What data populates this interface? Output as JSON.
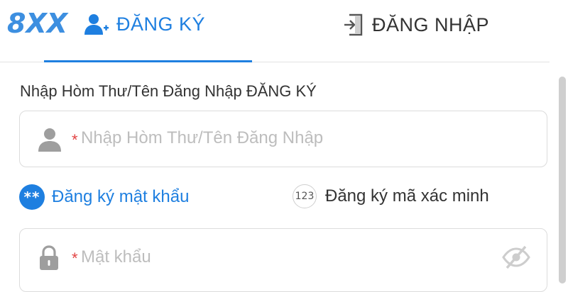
{
  "brand": {
    "logo_text": "8XX",
    "colors": {
      "primary": "#1e7fe0",
      "logo": "#3d8fe0",
      "required": "#e24444"
    }
  },
  "tabs": [
    {
      "label": "ĐĂNG KÝ",
      "icon": "user-add-icon",
      "active": true
    },
    {
      "label": "ĐĂNG NHẬP",
      "icon": "login-door-icon",
      "active": false
    }
  ],
  "account_field": {
    "label": "Nhập Hòm Thư/Tên Đăng Nhập ĐĂNG KÝ",
    "required_mark": "*",
    "placeholder": "Nhập Hòm Thư/Tên Đăng Nhập",
    "value": "",
    "icon": "user-icon"
  },
  "modes": [
    {
      "label": "Đăng ký mật khẩu",
      "badge": "**",
      "active": true
    },
    {
      "label": "Đăng ký mã xác minh",
      "badge": "123",
      "active": false
    }
  ],
  "password_field": {
    "required_mark": "*",
    "placeholder": "Mật khẩu",
    "value": "",
    "icon": "lock-icon",
    "toggle_icon": "eye-off-icon"
  }
}
